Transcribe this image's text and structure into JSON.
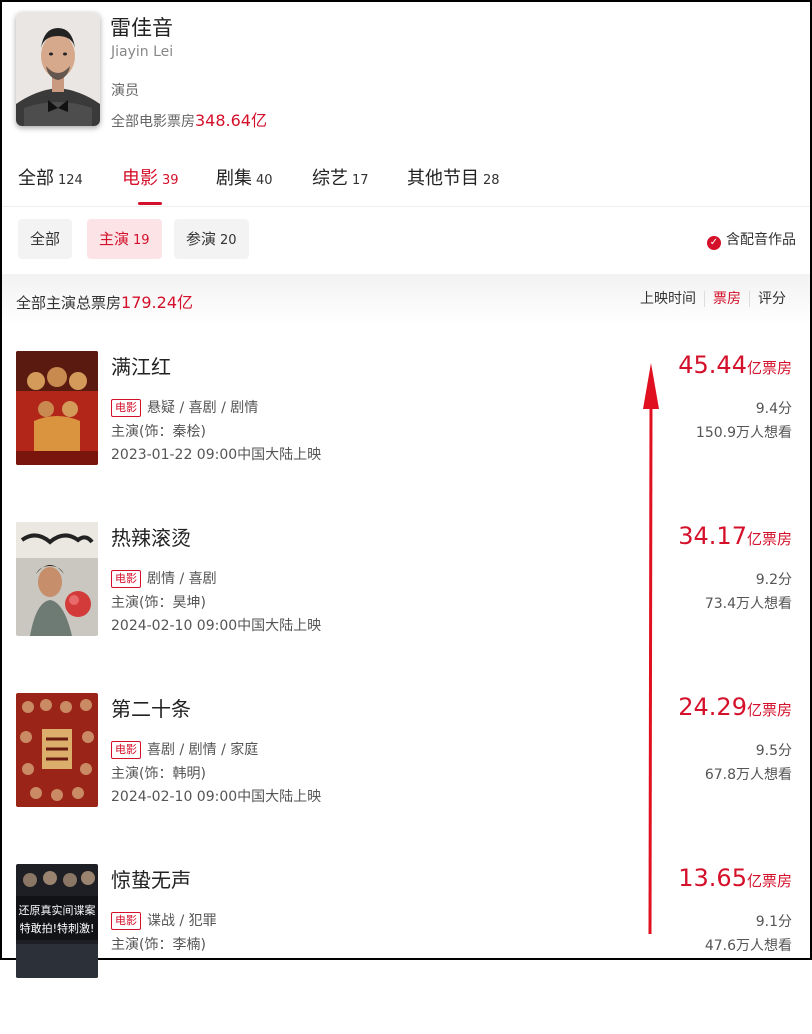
{
  "profile": {
    "name": "雷佳音",
    "english_name": "Jiayin Lei",
    "role": "演员",
    "box_office_label": "全部电影票房",
    "box_office_value": "348.64亿"
  },
  "tabs": [
    {
      "label": "全部",
      "count": "124"
    },
    {
      "label": "电影",
      "count": "39"
    },
    {
      "label": "剧集",
      "count": "40"
    },
    {
      "label": "综艺",
      "count": "17"
    },
    {
      "label": "其他节目",
      "count": "28"
    }
  ],
  "filters": [
    {
      "label": "全部",
      "count": ""
    },
    {
      "label": "主演",
      "count": "19"
    },
    {
      "label": "参演",
      "count": "20"
    }
  ],
  "dubbing_label": "含配音作品",
  "summary": {
    "label": "全部主演总票房",
    "value": "179.24亿"
  },
  "sort": [
    "上映时间",
    "票房",
    "评分"
  ],
  "movie_tag": "电影",
  "box_unit": "亿票房",
  "movies": [
    {
      "title": "满江红",
      "genres": "悬疑 / 喜剧 / 剧情",
      "role": "主演(饰：秦桧)",
      "date": "2023-01-22 09:00中国大陆上映",
      "box": "45.44",
      "score": "9.4分",
      "want": "150.9万人想看"
    },
    {
      "title": "热辣滚烫",
      "genres": "剧情 / 喜剧",
      "role": "主演(饰：昊坤)",
      "date": "2024-02-10 09:00中国大陆上映",
      "box": "34.17",
      "score": "9.2分",
      "want": "73.4万人想看"
    },
    {
      "title": "第二十条",
      "genres": "喜剧 / 剧情 / 家庭",
      "role": "主演(饰：韩明)",
      "date": "2024-02-10 09:00中国大陆上映",
      "box": "24.29",
      "score": "9.5分",
      "want": "67.8万人想看"
    },
    {
      "title": "惊蛰无声",
      "genres": "谍战 / 犯罪",
      "role": "主演(饰：李楠)",
      "date": "",
      "box": "13.65",
      "score": "9.1分",
      "want": "47.6万人想看"
    }
  ],
  "poster4_text": [
    "还原真实间谍案",
    "特敢拍!特刺激!"
  ],
  "colors": {
    "accent": "#d4102a"
  }
}
